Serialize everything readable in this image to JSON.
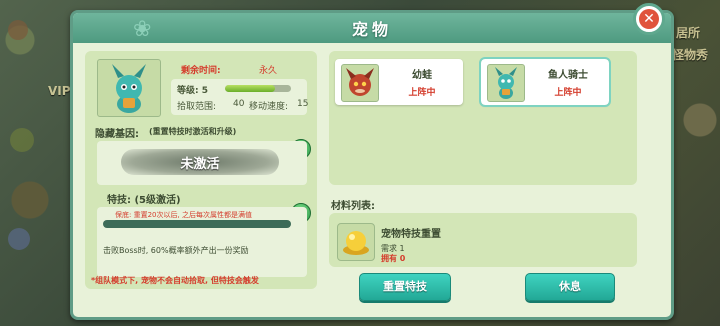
{
  "window": {
    "title": "宠物"
  },
  "background": {
    "left_labels": [
      "VIP"
    ],
    "right_labels": [
      "居所",
      "怪物秀"
    ]
  },
  "pet_info": {
    "remaining_time_label": "剩余时间:",
    "remaining_time_value": "永久",
    "level_label": "等级: 5",
    "level_progress": 0.75,
    "pickup_range_label": "拾取范围:",
    "pickup_range_value": "40",
    "move_speed_label": "移动速度:",
    "move_speed_value": "15"
  },
  "hidden_gene": {
    "label": "隐藏基因:",
    "note": "(重置特技时激活和升级)",
    "status": "未激活",
    "help_icon": "question-icon"
  },
  "skill": {
    "title": "特技: (5级激活)",
    "guarantee": "保底: 重置20次以后, 之后每次属性都是满值",
    "description": "击败Boss时, 60%概率额外产出一份奖励",
    "help_icon": "question-icon"
  },
  "team_note": "*组队模式下, 宠物不会自动拾取, 但特技会触发",
  "pets": [
    {
      "name": "幼蛙",
      "status": "上阵中",
      "selected": false
    },
    {
      "name": "鱼人骑士",
      "status": "上阵中",
      "selected": true
    }
  ],
  "materials": {
    "title": "材料列表:",
    "items": [
      {
        "name": "宠物特技重置",
        "required": "需求 1",
        "owned": "拥有 0",
        "icon": "golden-orb-icon"
      }
    ]
  },
  "buttons": {
    "reset_skill": "重置特技",
    "rest": "休息"
  },
  "colors": {
    "accent": "#22a896",
    "warning": "#d43c2c",
    "panel": "#e8f2d9",
    "title_bar": "#4e9a80"
  }
}
